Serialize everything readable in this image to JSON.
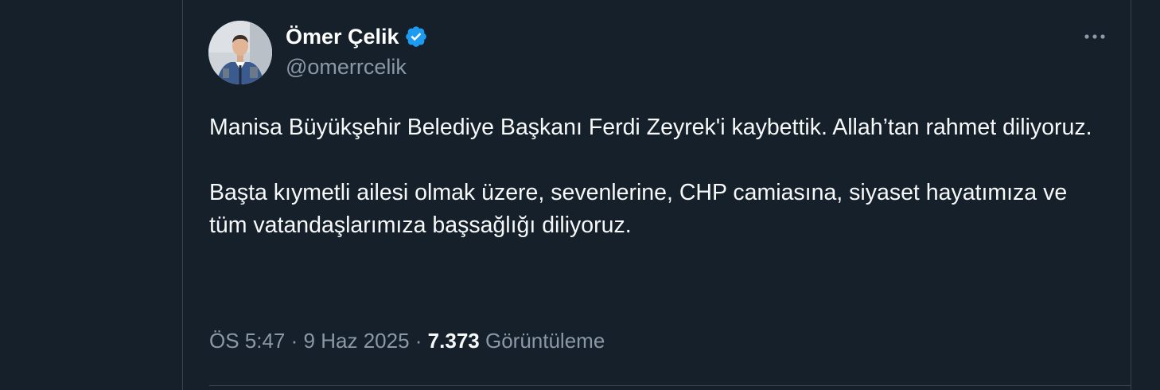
{
  "tweet": {
    "author": {
      "display_name": "Ömer Çelik",
      "handle": "@omerrcelik",
      "verified": true
    },
    "paragraphs": [
      "Manisa Büyükşehir Belediye Başkanı Ferdi Zeyrek'i kaybettik.  Allah’tan rahmet diliyoruz.",
      "Başta kıymetli ailesi olmak üzere, sevenlerine, CHP camiasına, siyaset hayatımıza ve tüm vatandaşlarımıza başsağlığı diliyoruz."
    ],
    "time": "ÖS 5:47",
    "separator": "·",
    "date": "9 Haz 2025",
    "views_count": "7.373",
    "views_label": "Görüntüleme"
  },
  "icons": {
    "verified": "verified-badge-icon",
    "more": "more-options-icon"
  },
  "colors": {
    "background": "#15202b",
    "text_primary": "#f7f9f9",
    "text_secondary": "#8b98a5",
    "verified_blue": "#1d9bf0",
    "border": "#38444d"
  }
}
